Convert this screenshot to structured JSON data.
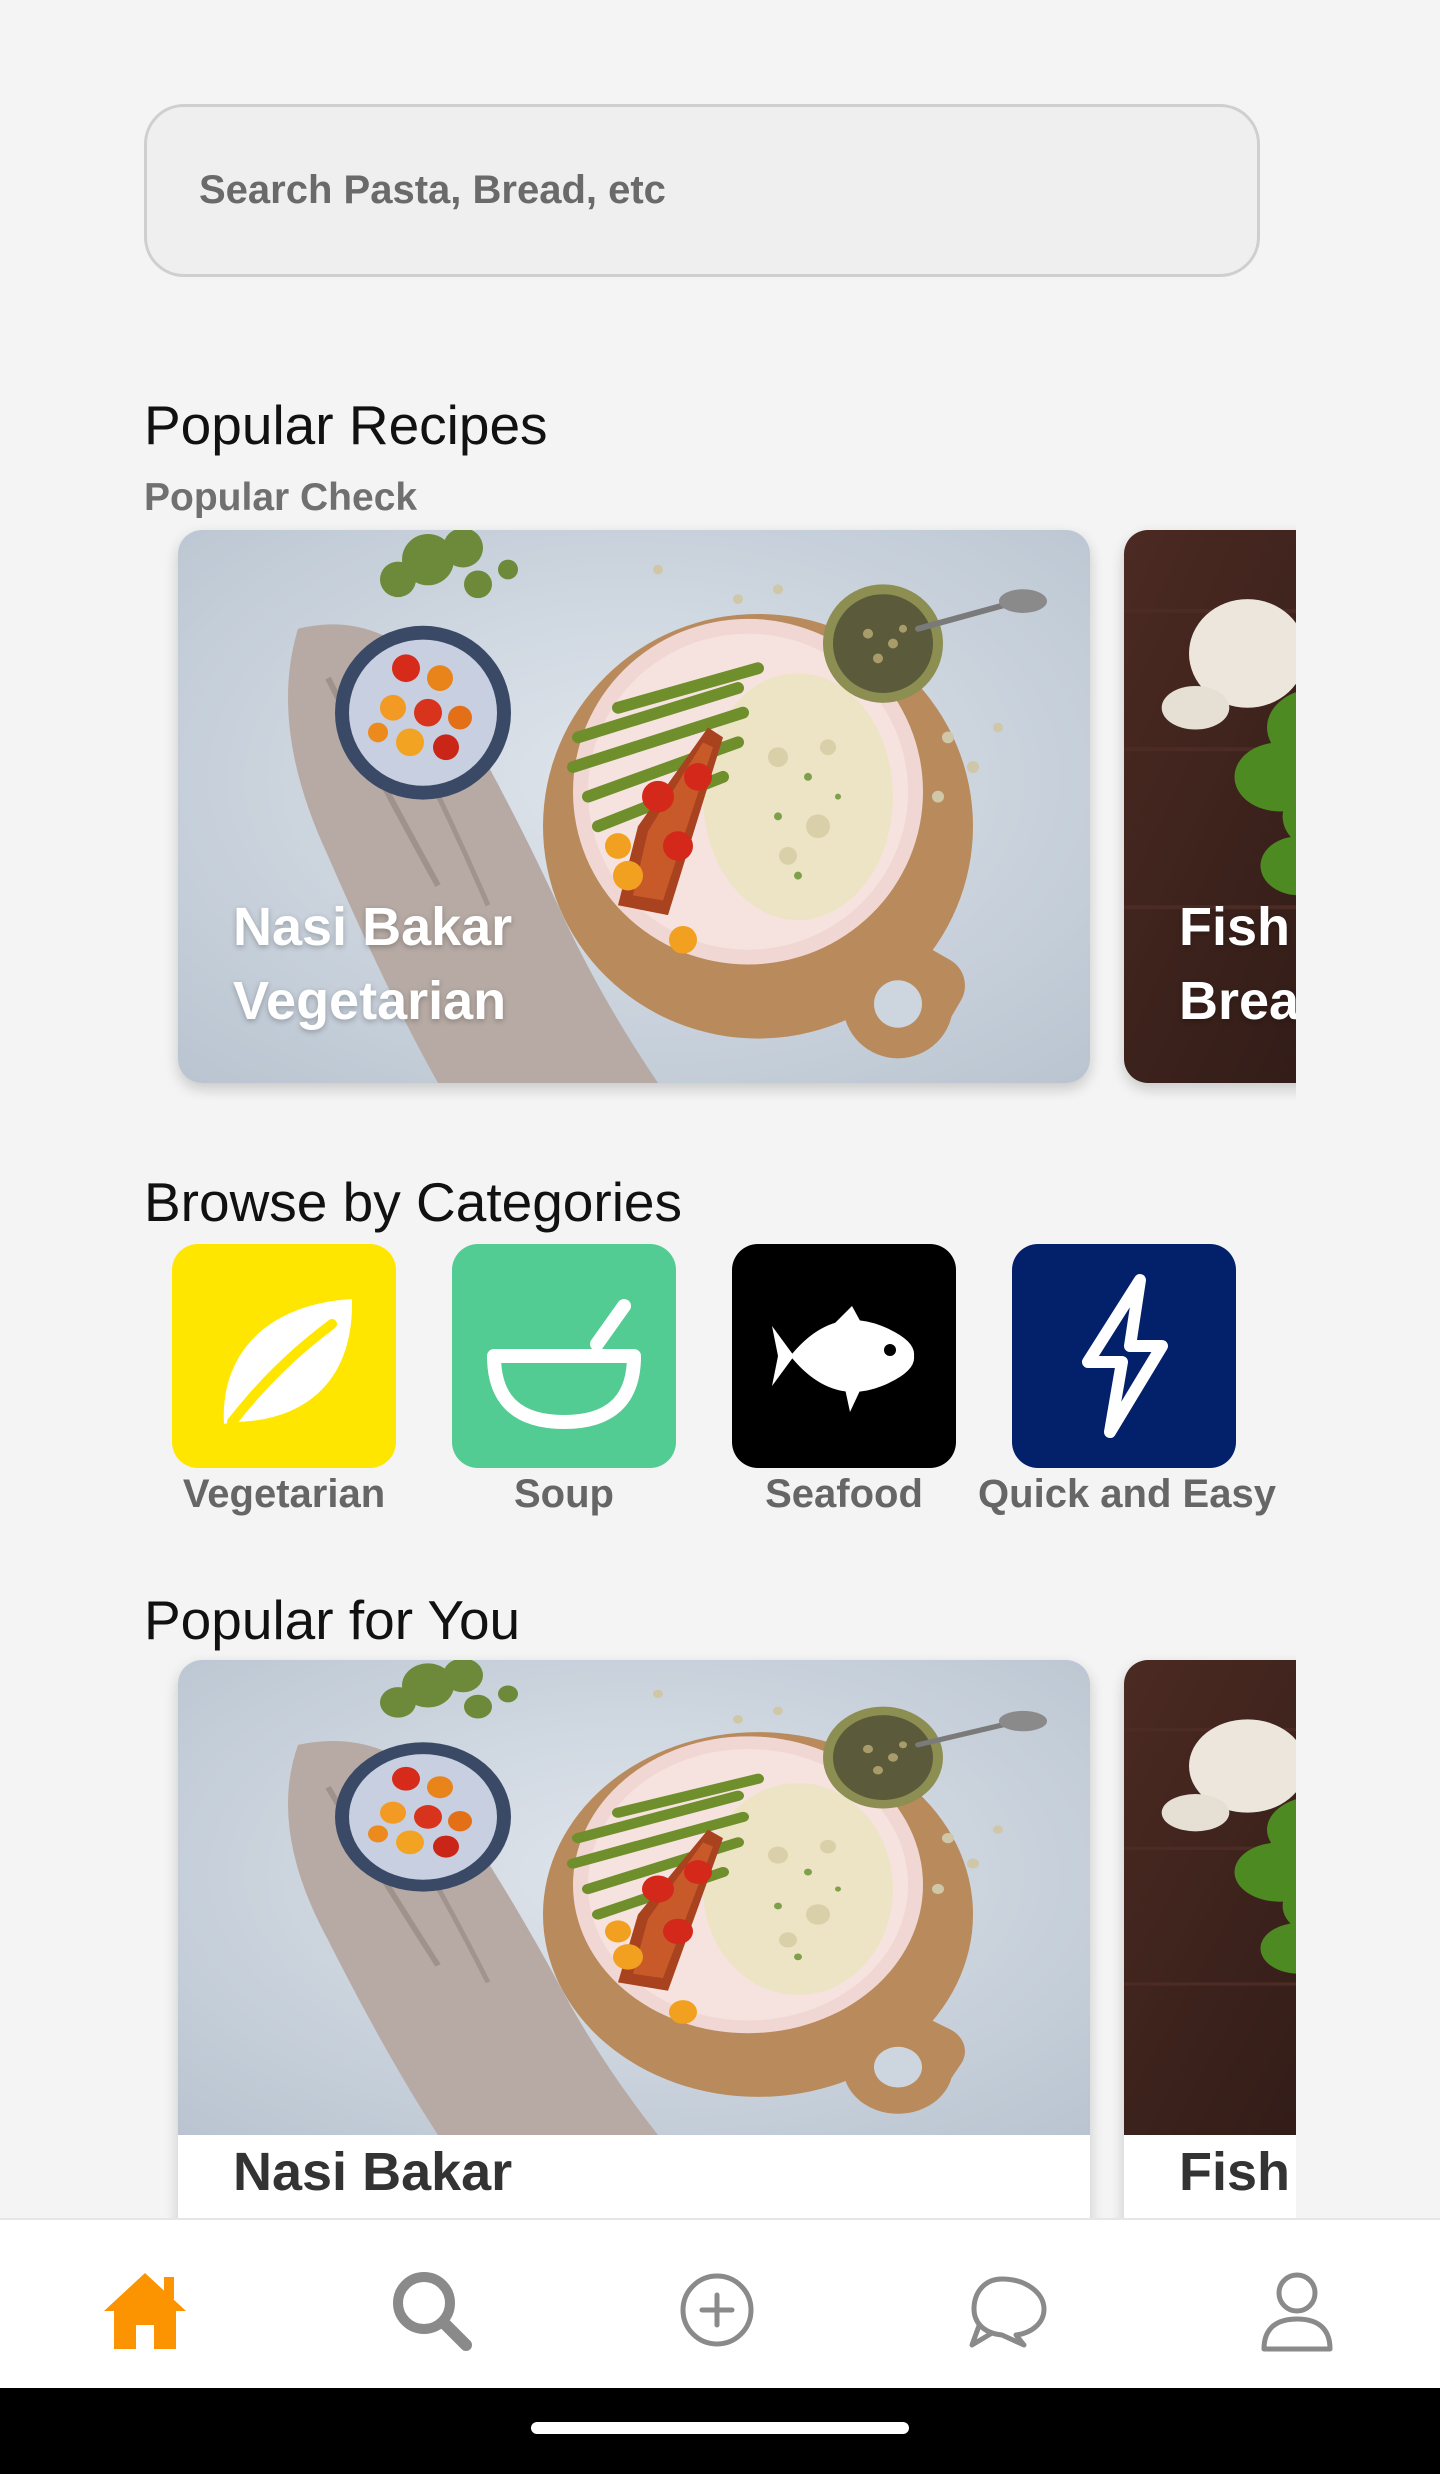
{
  "search": {
    "placeholder": "Search Pasta, Bread, etc",
    "value": ""
  },
  "popular_recipes": {
    "title": "Popular Recipes",
    "subtitle": "Popular Check",
    "cards": [
      {
        "title_line1": "Nasi Bakar",
        "title_line2": "Vegetarian"
      },
      {
        "title_line1": "Fish",
        "title_line2": "Brea"
      }
    ]
  },
  "categories": {
    "title": "Browse by Categories",
    "items": [
      {
        "label": "Vegetarian",
        "icon": "leaf-icon",
        "color": "#ffe600"
      },
      {
        "label": "Soup",
        "icon": "bowl-icon",
        "color": "#52cc92"
      },
      {
        "label": "Seafood",
        "icon": "fish-icon",
        "color": "#000000"
      },
      {
        "label": "Quick and Easy",
        "icon": "lightning-icon",
        "color": "#03206b"
      }
    ]
  },
  "popular_for_you": {
    "title": "Popular for You",
    "cards": [
      {
        "title": "Nasi Bakar"
      },
      {
        "title": "Fish"
      }
    ]
  },
  "bottom_nav": {
    "items": [
      {
        "icon": "home-icon",
        "active": true
      },
      {
        "icon": "search-icon",
        "active": false
      },
      {
        "icon": "add-icon",
        "active": false
      },
      {
        "icon": "chat-icon",
        "active": false
      },
      {
        "icon": "profile-icon",
        "active": false
      }
    ],
    "active_color": "#fb9400",
    "inactive_color": "#8a8a8a"
  }
}
